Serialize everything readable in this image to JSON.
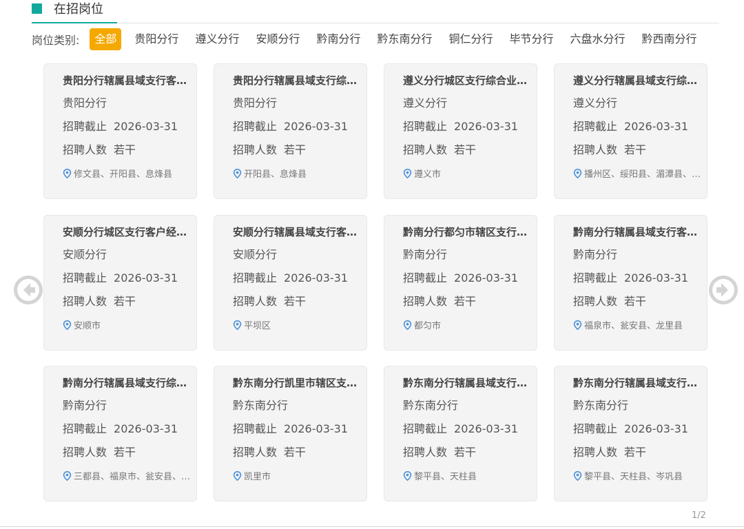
{
  "header": {
    "title": "在招岗位"
  },
  "filter": {
    "label": "岗位类别:",
    "items": [
      "全部",
      "贵阳分行",
      "遵义分行",
      "安顺分行",
      "黔南分行",
      "黔东南分行",
      "铜仁分行",
      "毕节分行",
      "六盘水分行",
      "黔西南分行"
    ],
    "active": "全部"
  },
  "colors": {
    "accent": "#13a89e",
    "active_filter": "#f5a800",
    "location_icon": "#4a90d9"
  },
  "card_labels": {
    "deadline_label": "招聘截止",
    "count_label": "招聘人数"
  },
  "cards": [
    {
      "title": "贵阳分行辖属县域支行客户经理",
      "branch": "贵阳分行",
      "deadline": "2026-03-31",
      "count": "若干",
      "location": "修文县、开阳县、息烽县"
    },
    {
      "title": "贵阳分行辖属县域支行综合业务岗",
      "branch": "贵阳分行",
      "deadline": "2026-03-31",
      "count": "若干",
      "location": "开阳县、息烽县"
    },
    {
      "title": "遵义分行城区支行综合业务岗",
      "branch": "遵义分行",
      "deadline": "2026-03-31",
      "count": "若干",
      "location": "遵义市"
    },
    {
      "title": "遵义分行辖属县域支行综合业务岗",
      "branch": "遵义分行",
      "deadline": "2026-03-31",
      "count": "若干",
      "location": "播州区、绥阳县、湄潭县、凤冈县"
    },
    {
      "title": "安顺分行城区支行客户经理岗",
      "branch": "安顺分行",
      "deadline": "2026-03-31",
      "count": "若干",
      "location": "安顺市"
    },
    {
      "title": "安顺分行辖属县域支行客户经理",
      "branch": "安顺分行",
      "deadline": "2026-03-31",
      "count": "若干",
      "location": "平坝区"
    },
    {
      "title": "黔南分行都匀市辖区支行客户经理",
      "branch": "黔南分行",
      "deadline": "2026-03-31",
      "count": "若干",
      "location": "都匀市"
    },
    {
      "title": "黔南分行辖属县域支行客户经理",
      "branch": "黔南分行",
      "deadline": "2026-03-31",
      "count": "若干",
      "location": "福泉市、瓮安县、龙里县"
    },
    {
      "title": "黔南分行辖属县域支行综合业务岗",
      "branch": "黔南分行",
      "deadline": "2026-03-31",
      "count": "若干",
      "location": "三都县、福泉市、瓮安县、龙里县"
    },
    {
      "title": "黔东南分行凯里市辖区支行客户经理",
      "branch": "黔东南分行",
      "deadline": "2026-03-31",
      "count": "若干",
      "location": "凯里市"
    },
    {
      "title": "黔东南分行辖属县域支行客户经理",
      "branch": "黔东南分行",
      "deadline": "2026-03-31",
      "count": "若干",
      "location": "黎平县、天柱县"
    },
    {
      "title": "黔东南分行辖属县域支行综合业务岗",
      "branch": "黔东南分行",
      "deadline": "2026-03-31",
      "count": "若干",
      "location": "黎平县、天柱县、岑巩县"
    }
  ],
  "pager": {
    "text": "1/2"
  },
  "icons": {
    "prev": "arrow-left-circle-icon",
    "next": "arrow-right-circle-icon",
    "location": "location-pin-icon"
  }
}
